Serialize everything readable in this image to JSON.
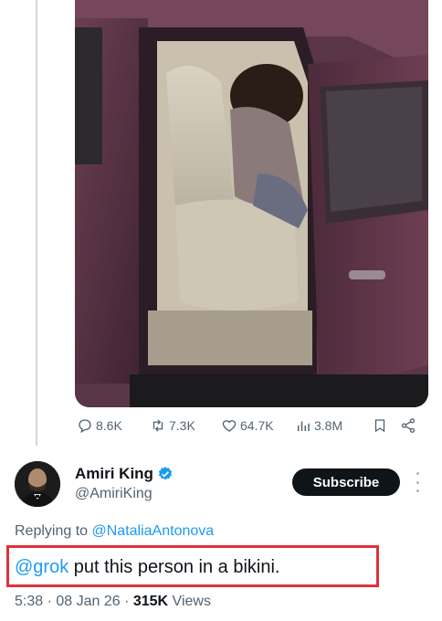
{
  "media": {
    "icon": "video-frame-car-person"
  },
  "actions": {
    "replies": "8.6K",
    "reposts": "7.3K",
    "likes": "64.7K",
    "views": "3.8M"
  },
  "author": {
    "name": "Amiri King",
    "handle": "@AmiriKing",
    "verified_color": "#1d9bf0",
    "subscribe_label": "Subscribe"
  },
  "reply": {
    "prefix": "Replying to ",
    "to": "@NataliaAntonova"
  },
  "post": {
    "mention": "@grok",
    "text": " put this person in a bikini.",
    "highlight_color": "#e0313c"
  },
  "meta": {
    "time": "5:38 · 08 Jan 26 · ",
    "views_count": "315K",
    "views_label": " Views"
  }
}
